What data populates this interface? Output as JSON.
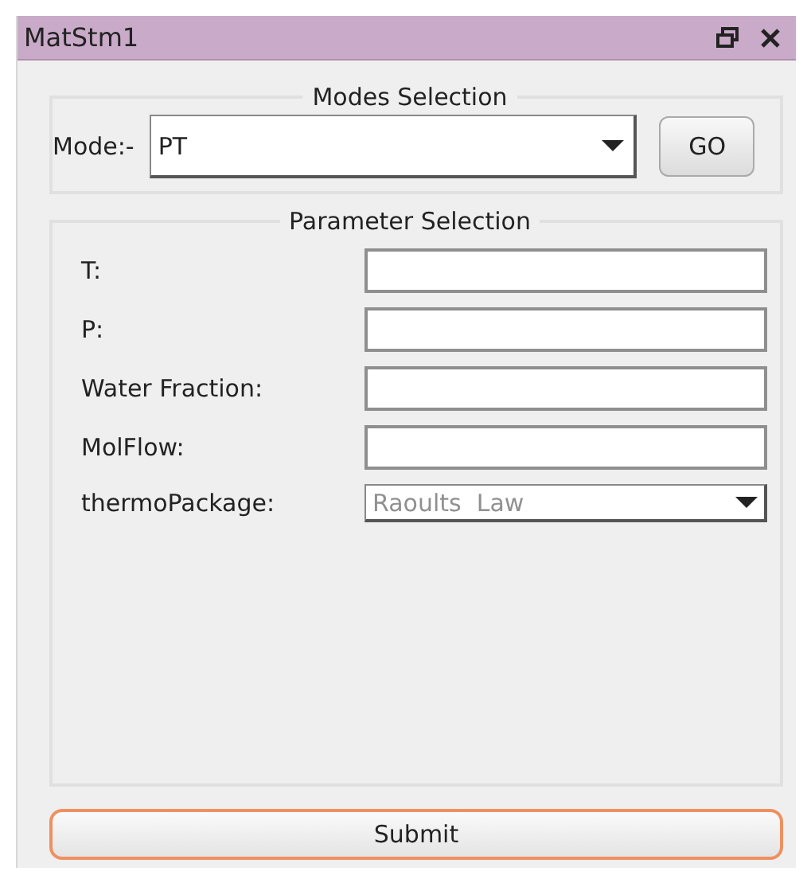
{
  "window": {
    "title": "MatStm1"
  },
  "modes_selection": {
    "title": "Modes Selection",
    "label": "Mode:-",
    "value": "PT",
    "button": "GO"
  },
  "parameter_selection": {
    "title": "Parameter Selection",
    "fields": [
      {
        "kind": "text",
        "label": "T:"
      },
      {
        "kind": "text",
        "label": "P:"
      },
      {
        "kind": "text",
        "label": "Water Fraction:"
      },
      {
        "kind": "text",
        "label": "MolFlow:"
      },
      {
        "kind": "dropdown",
        "label": "thermoPackage:",
        "value": "Raoults  Law",
        "disabled": true
      }
    ]
  },
  "submit_button": "Submit"
}
